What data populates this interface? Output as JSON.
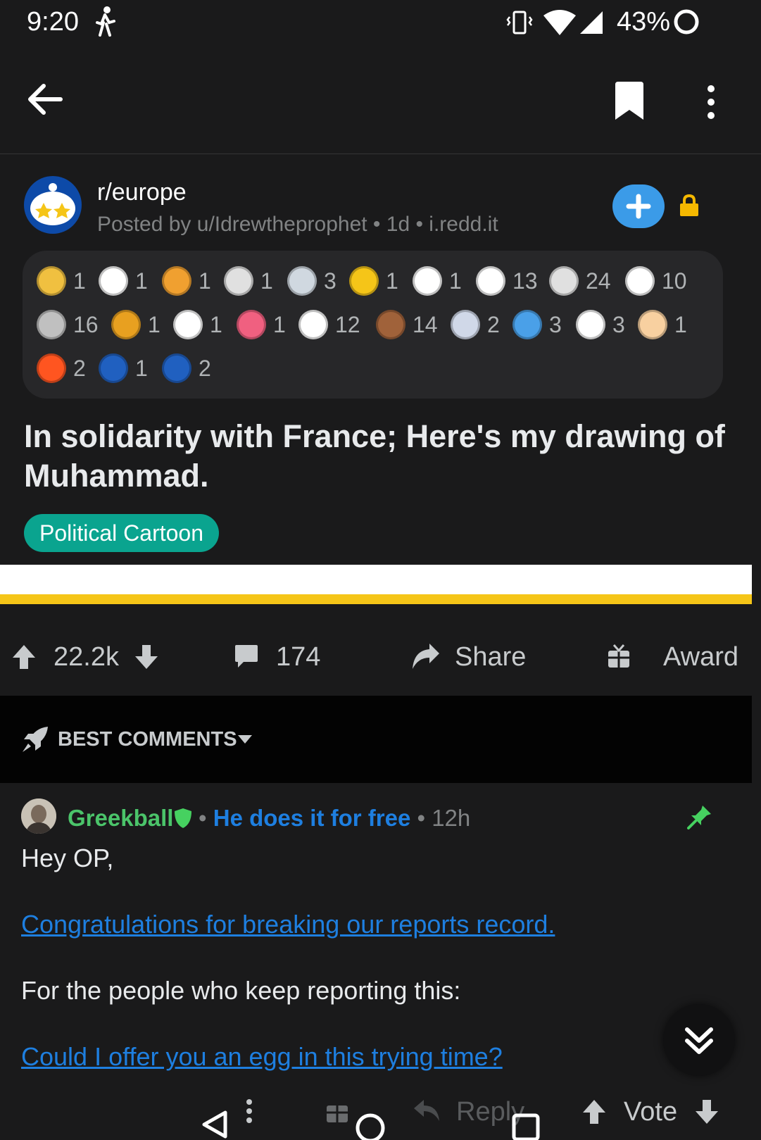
{
  "status_bar": {
    "time": "9:20",
    "battery": "43%"
  },
  "post": {
    "subreddit": "r/europe",
    "meta": "Posted by u/Idrewtheprophet • 1d • i.redd.it",
    "title": "In solidarity with France; Here's my drawing of Muhammad.",
    "flair": "Political Cartoon",
    "awards": [
      {
        "icon": "sun-award-icon",
        "count": "1",
        "color": "#f0c040"
      },
      {
        "icon": "party-award-icon",
        "count": "1",
        "color": "#ffffff"
      },
      {
        "icon": "pirate-award-icon",
        "count": "1",
        "color": "#f0a030"
      },
      {
        "icon": "train-award-icon",
        "count": "1",
        "color": "#e0e0e0"
      },
      {
        "icon": "globe-award-icon",
        "count": "3",
        "color": "#d0d8e0"
      },
      {
        "icon": "star-award-icon",
        "count": "1",
        "color": "#f5c518"
      },
      {
        "icon": "snoo-hat-award-icon",
        "count": "1",
        "color": "#ffffff"
      },
      {
        "icon": "thumbsup-award-icon",
        "count": "13",
        "color": "#ffffff"
      },
      {
        "icon": "handshake-award-icon",
        "count": "24",
        "color": "#e0e0e0"
      },
      {
        "icon": "wink-award-icon",
        "count": "10",
        "color": "#ffffff"
      },
      {
        "icon": "dollar-award-icon",
        "count": "16",
        "color": "#c0c0c0"
      },
      {
        "icon": "frame-award-icon",
        "count": "1",
        "color": "#e8a020"
      },
      {
        "icon": "dizzy-award-icon",
        "count": "1",
        "color": "#ffffff"
      },
      {
        "icon": "heart-award-icon",
        "count": "1",
        "color": "#f06080"
      },
      {
        "icon": "excited-award-icon",
        "count": "12",
        "color": "#ffffff"
      },
      {
        "icon": "bear-award-icon",
        "count": "14",
        "color": "#a0623a"
      },
      {
        "icon": "cat-award-icon",
        "count": "2",
        "color": "#d0d8e8"
      },
      {
        "icon": "facepalm-award-icon",
        "count": "3",
        "color": "#4aa0e8"
      },
      {
        "icon": "snoo-award-icon",
        "count": "3",
        "color": "#ffffff"
      },
      {
        "icon": "love-award-icon",
        "count": "1",
        "color": "#f8d0a0"
      },
      {
        "icon": "arrow-up-award-icon",
        "count": "2",
        "color": "#ff5520"
      },
      {
        "icon": "voted-award-icon",
        "count": "1",
        "color": "#2060c0"
      },
      {
        "icon": "vote-award-icon",
        "count": "2",
        "color": "#2060c0"
      }
    ],
    "score": "22.2k",
    "comments": "174",
    "share_label": "Share",
    "award_label": "Award"
  },
  "sort": {
    "label": "BEST COMMENTS"
  },
  "comment": {
    "author": "Greekball",
    "flair": "He does it for free",
    "flair_color": "#1e7fe0",
    "time": "12h",
    "line1": "Hey OP,",
    "link1": "Congratulations for breaking our reports record.",
    "line2": "For the people who keep reporting this:",
    "link2": "Could I offer you an egg in this trying time?",
    "reply_label": "Reply",
    "vote_label": "Vote"
  }
}
